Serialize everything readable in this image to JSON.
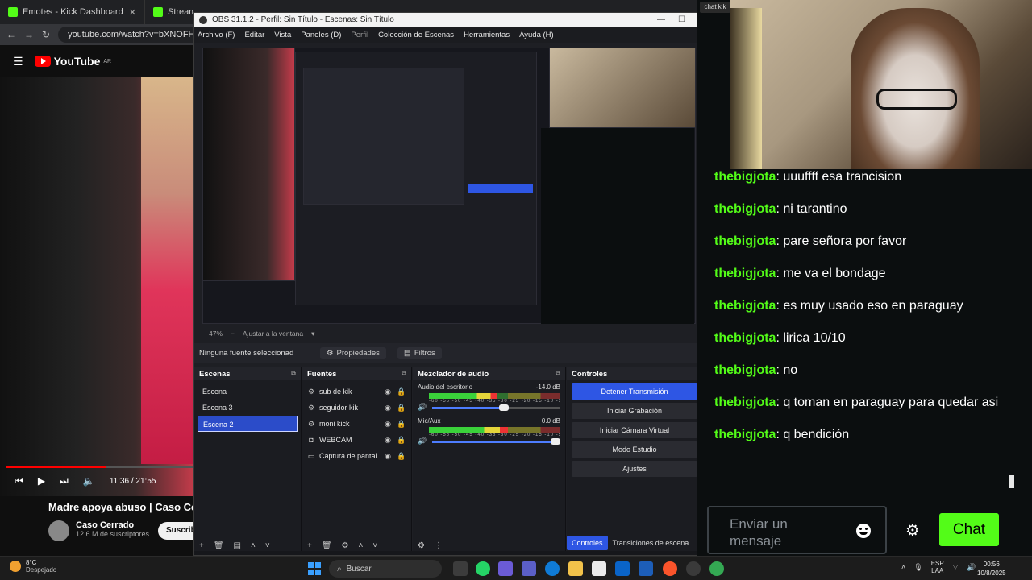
{
  "browser": {
    "tabs": [
      {
        "label": "Emotes - Kick Dashboard",
        "color": "#53fc18"
      },
      {
        "label": "Stream - Kick Dashboard",
        "color": "#53fc18"
      }
    ],
    "url": "youtube.com/watch?v=bXNOFH"
  },
  "youtube": {
    "logo_text": "YouTube",
    "region": "AR",
    "time": "11:36 / 21:55",
    "progress": 0.53,
    "video_title": "Madre apoya abuso | Caso Cer",
    "channel": "Caso Cerrado",
    "subscribers": "12.6 M de suscriptores",
    "subscribe": "Suscrib"
  },
  "obs": {
    "title": "OBS 31.1.2 - Perfil: Sin Título - Escenas: Sin Título",
    "menu": [
      "Archivo (F)",
      "Editar",
      "Vista",
      "Paneles (D)",
      "Perfil",
      "Colección de Escenas",
      "Herramientas",
      "Ayuda (H)"
    ],
    "zoom": "47%",
    "fit": "Ajustar a la ventana",
    "no_source": "Ninguna fuente seleccionad",
    "properties": "Propiedades",
    "filters": "Filtros",
    "scenes_title": "Escenas",
    "scenes": [
      "Escena",
      "Escena 3",
      "Escena 2"
    ],
    "selected_scene": 2,
    "sources_title": "Fuentes",
    "sources": [
      {
        "name": "sub de kik",
        "icon": "gear-icon"
      },
      {
        "name": "seguidor kik",
        "icon": "gear-icon"
      },
      {
        "name": "moni kick",
        "icon": "gear-icon"
      },
      {
        "name": "WEBCAM",
        "icon": "camera-icon"
      },
      {
        "name": "Captura de pantal",
        "icon": "monitor-icon"
      }
    ],
    "mixer_title": "Mezclador de audio",
    "mixer": [
      {
        "name": "Audio del escritorio",
        "db": "-14.0 dB",
        "level": 0.52,
        "volume": 0.6
      },
      {
        "name": "Mic/Aux",
        "db": "0.0 dB",
        "level": 0.6,
        "volume": 1.0
      }
    ],
    "meter_scale": "-60 -55 -50 -45 -40 -35 -30 -25 -20 -15 -10 -5 0",
    "controls_title": "Controles",
    "controls": [
      "Detener Transmisión",
      "Iniciar Grabación",
      "Iniciar Cámara Virtual",
      "Modo Estudio",
      "Ajustes"
    ],
    "bottom_tabs": [
      "Controles",
      "Transiciones de escena"
    ]
  },
  "chat": {
    "tooltip": "chat kik",
    "messages": [
      {
        "user": "thebigjota",
        "text": "uuuffff esa trancision"
      },
      {
        "user": "thebigjota",
        "text": "ni tarantino"
      },
      {
        "user": "thebigjota",
        "text": "pare señora por favor"
      },
      {
        "user": "thebigjota",
        "text": "me va el bondage"
      },
      {
        "user": "thebigjota",
        "text": "es muy usado eso en paraguay"
      },
      {
        "user": "thebigjota",
        "text": "lirica 10/10"
      },
      {
        "user": "thebigjota",
        "text": "no"
      },
      {
        "user": "thebigjota",
        "text": "q toman en paraguay para quedar asi"
      },
      {
        "user": "thebigjota",
        "text": "q bendición"
      }
    ],
    "placeholder": "Enviar un mensaje",
    "send": "Chat",
    "accent": "#53fc18"
  },
  "taskbar": {
    "temp": "8°C",
    "weather": "Despejado",
    "search": "Buscar",
    "lang1": "ESP",
    "lang2": "LAA",
    "time": "00:56",
    "date": "10/8/2025"
  }
}
